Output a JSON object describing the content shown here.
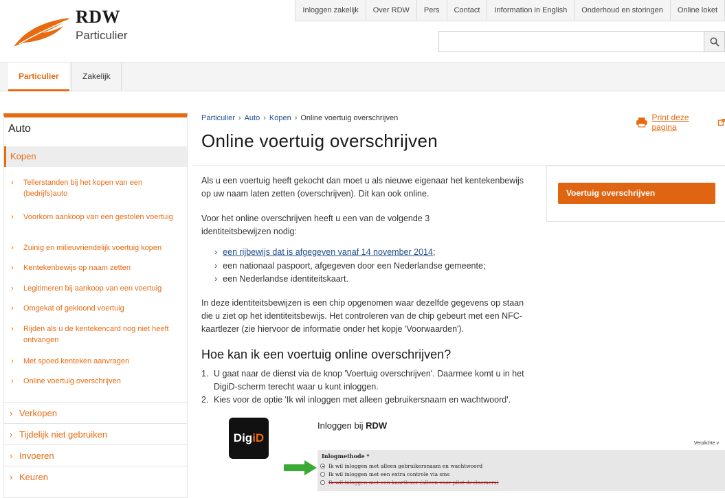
{
  "header": {
    "brand": "RDW",
    "sub": "Particulier",
    "top_links": [
      "Inloggen zakelijk",
      "Over RDW",
      "Pers",
      "Contact",
      "Information in English",
      "Onderhoud en storingen",
      "Online loket"
    ],
    "search_placeholder": ""
  },
  "mainnav": {
    "tabs": [
      "Particulier",
      "Zakelijk"
    ],
    "active": "Particulier"
  },
  "sidebar": {
    "title": "Auto",
    "category": "Kopen",
    "sub_items": [
      "Tellerstanden bij het kopen van een (bedrijfs)auto",
      "Voorkom aankoop van een gestolen voertuig",
      "Zuinig en milieuvriendelijk voertuig kopen",
      "Kentekenbewijs op naam zetten",
      "Legitimeren bij aankoop van een voertuig",
      "Omgekat of gekloond voertuig",
      "Rijden als u de kentekencard nog niet heeft ontvangen",
      "Met spoed kenteken aanvragen",
      "Online voertuig overschrijven"
    ],
    "top_items": [
      "Verkopen",
      "Tijdelijk niet gebruiken",
      "Invoeren",
      "Keuren"
    ]
  },
  "content": {
    "breadcrumb": [
      "Particulier",
      "Auto",
      "Kopen",
      "Online voertuig overschrijven"
    ],
    "print_label": "Print deze pagina",
    "title": "Online voertuig overschrijven",
    "p1": "Als u een voertuig heeft gekocht dan moet u als nieuwe eigenaar het kentekenbewijs op uw naam laten zetten (overschrijven). Dit kan ook online.",
    "p2": "Voor het online overschrijven heeft u een van de volgende 3 identiteitsbewijzen nodig:",
    "bullets": [
      "een rijbewijs dat is afgegeven vanaf 14 november 2014",
      "een nationaal paspoort, afgegeven door een Nederlandse gemeente;",
      "een Nederlandse identiteitskaart."
    ],
    "bullet1_suffix": ";",
    "p3": "In deze identiteitsbewijzen is een chip opgenomen waar dezelfde gegevens op staan die u ziet op het identiteitsbewijs. Het controleren van de chip gebeurt met een NFC-kaartlezer (zie hiervoor de informatie onder het kopje 'Voorwaarden').",
    "h2": "Hoe kan ik een voertuig online overschrijven?",
    "steps": [
      "U gaat naar de dienst via de knop 'Voertuig overschrijven'. Daarmee komt u in het DigiD-scherm terecht waar u kunt inloggen.",
      "Kies voor de optie 'Ik wil inloggen met alleen gebruikersnaam en wachtwoord'."
    ],
    "cta": "Voertuig overschrijven"
  },
  "digid": {
    "logo_a": "Dig",
    "logo_b": "iD",
    "login_prefix": "Inloggen bij ",
    "login_org": "RDW",
    "verplicht": "Verplichte v",
    "method_title": "Inlogmethode *",
    "options": [
      "Ik wil inloggen met alleen gebruikersnaam en wachtwoord",
      "Ik wil inloggen met een extra controle via sms",
      "Ik wil inloggen met een kaartlezer (alleen voor pilot deelnemers)"
    ]
  },
  "colors": {
    "accent": "#e86a10",
    "link": "#1f4e8c",
    "arrow": "#3aaa35"
  }
}
